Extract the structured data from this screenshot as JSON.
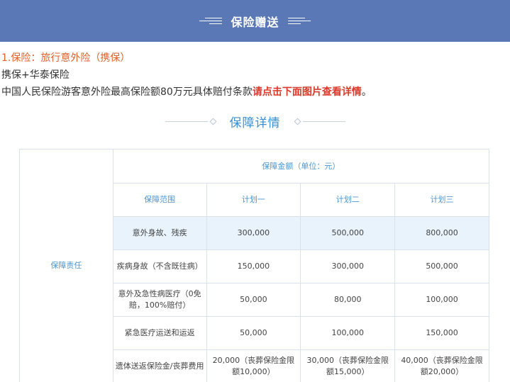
{
  "banner": {
    "title": "保险赠送"
  },
  "intro": {
    "line1": "1.保险：旅行意外险（携保）",
    "line2": "携保+华泰保险",
    "line3_plain": "中国人民保险游客意外险最高保险额80万元具体赔付条款",
    "line3_emph": "请点击下面图片查看详情",
    "line3_end": "。"
  },
  "section": {
    "title": "保障详情"
  },
  "table": {
    "row_header": "保障责任",
    "amount_header": "保障金额（单位：元）",
    "columns": [
      "保障范围",
      "计划一",
      "计划二",
      "计划三"
    ],
    "rows": [
      {
        "item": "意外身故、残疾",
        "values": [
          "300,000",
          "500,000",
          "800,000"
        ]
      },
      {
        "item": "疾病身故（不含既往病）",
        "values": [
          "150,000",
          "300,000",
          "500,000"
        ]
      },
      {
        "item": "意外及急性病医疗（0免赔，100%赔付）",
        "values": [
          "50,000",
          "80,000",
          "100,000"
        ]
      },
      {
        "item": "紧急医疗运送和运返",
        "values": [
          "50,000",
          "100,000",
          "150,000"
        ]
      },
      {
        "item": "遗体送返保险金/丧葬费用",
        "values": [
          "20,000（丧葬保险金限额10,000）",
          "30,000（丧葬保险金限额15,000）",
          "40,000（丧葬保险金限额20,000）"
        ]
      }
    ]
  }
}
